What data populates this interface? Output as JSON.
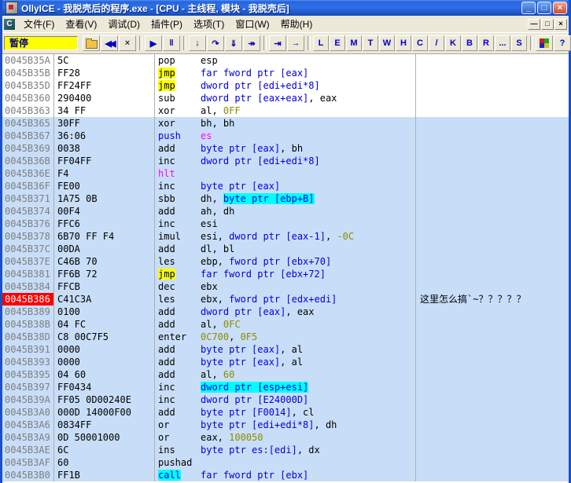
{
  "window": {
    "title": "OllyICE - 我脱壳后的程序.exe - [CPU - 主线程, 模块 - 我脱壳后]",
    "controls": {
      "minimize": "_",
      "maximize": "□",
      "close": "×"
    }
  },
  "menu": {
    "mdi_icon_label": "C",
    "items": [
      "文件(F)",
      "查看(V)",
      "调试(D)",
      "插件(P)",
      "选项(T)",
      "窗口(W)",
      "帮助(H)"
    ],
    "mdi": {
      "minimize": "―",
      "restore": "□",
      "close": "×"
    }
  },
  "toolbar": {
    "status_label": "暂停",
    "buttons": [
      {
        "name": "open-file-button",
        "icon": "folder-icon"
      },
      {
        "name": "restart-button",
        "glyph": "◀◀",
        "color": "#0000C0"
      },
      {
        "name": "close-program-button",
        "glyph": "×",
        "color": "#303030"
      },
      {
        "sep": true
      },
      {
        "name": "run-button",
        "glyph": "▶",
        "color": "#0000C0"
      },
      {
        "name": "pause-button",
        "glyph": "‖",
        "color": "#0000C0"
      },
      {
        "sep": true
      },
      {
        "name": "step-into-button",
        "glyph": "↓",
        "color": "#0000C0"
      },
      {
        "name": "step-over-button",
        "glyph": "↷",
        "color": "#0000C0"
      },
      {
        "name": "animate-into-button",
        "glyph": "⇓",
        "color": "#0000C0"
      },
      {
        "name": "animate-over-button",
        "glyph": "↠",
        "color": "#0000C0"
      },
      {
        "sep": true
      },
      {
        "name": "execute-till-return-button",
        "glyph": "⇥",
        "color": "#0000C0"
      },
      {
        "name": "go-to-address-button",
        "glyph": "→",
        "color": "#0000C0"
      },
      {
        "sep": true
      }
    ],
    "window_buttons": [
      {
        "name": "log-window-button",
        "label": "L"
      },
      {
        "name": "executables-window-button",
        "label": "E"
      },
      {
        "name": "memory-window-button",
        "label": "M"
      },
      {
        "name": "threads-window-button",
        "label": "T"
      },
      {
        "name": "windows-window-button",
        "label": "W"
      },
      {
        "name": "handles-window-button",
        "label": "H"
      },
      {
        "name": "cpu-window-button",
        "label": "C"
      },
      {
        "name": "patches-window-button",
        "label": "/"
      },
      {
        "name": "call-stack-window-button",
        "label": "K"
      },
      {
        "name": "breakpoints-window-button",
        "label": "B"
      },
      {
        "name": "references-window-button",
        "label": "R"
      },
      {
        "name": "run-trace-window-button",
        "label": "..."
      },
      {
        "name": "source-window-button",
        "label": "S"
      }
    ],
    "right_buttons": [
      {
        "name": "appearance-button",
        "icon": "palette-icon"
      },
      {
        "name": "help-button",
        "glyph": "?",
        "color": "#0000C0"
      }
    ]
  },
  "colors": {
    "selection_bg": "#C8DEF8",
    "breakpoint_bg": "#FF0000",
    "jump_highlight_bg": "#FFFF00",
    "operand_highlight_bg": "#00FFFF",
    "memory_operand": "#0000D8",
    "constant": "#8B8B00",
    "status_bg": "#FFFF00"
  },
  "disassembly": {
    "rows": [
      {
        "address": "0045B35A",
        "bytes": "5C",
        "mnemonic": "pop",
        "operands": [
          {
            "t": "esp",
            "s": "reg"
          }
        ],
        "selected": false
      },
      {
        "address": "0045B35B",
        "bytes": "FF28",
        "mnemonic": "jmp",
        "mstyle": "jmp",
        "operands": [
          {
            "t": "far fword ptr [eax]",
            "s": "mem"
          }
        ],
        "selected": false
      },
      {
        "address": "0045B35D",
        "bytes": "FF24FF",
        "mnemonic": "jmp",
        "mstyle": "jmp",
        "operands": [
          {
            "t": "dword ptr [edi+edi*8]",
            "s": "mem"
          }
        ],
        "selected": false
      },
      {
        "address": "0045B360",
        "bytes": "290400",
        "mnemonic": "sub",
        "operands": [
          {
            "t": "dword ptr [eax+eax]",
            "s": "mem"
          },
          {
            "t": ", ",
            "s": "reg"
          },
          {
            "t": "eax",
            "s": "reg"
          }
        ],
        "selected": false
      },
      {
        "address": "0045B363",
        "bytes": "34 FF",
        "mnemonic": "xor",
        "operands": [
          {
            "t": "al, ",
            "s": "reg"
          },
          {
            "t": "0FF",
            "s": "const"
          }
        ],
        "selected": false
      },
      {
        "address": "0045B365",
        "bytes": "30FF",
        "mnemonic": "xor",
        "operands": [
          {
            "t": "bh, bh",
            "s": "reg"
          }
        ],
        "selected": true
      },
      {
        "address": "0045B367",
        "bytes": "36:06",
        "mnemonic": "push",
        "mstyle": "push",
        "operands": [
          {
            "t": "es",
            "s": "seg"
          }
        ],
        "selected": true
      },
      {
        "address": "0045B369",
        "bytes": "0038",
        "mnemonic": "add",
        "operands": [
          {
            "t": "byte ptr [eax]",
            "s": "mem"
          },
          {
            "t": ", ",
            "s": "reg"
          },
          {
            "t": "bh",
            "s": "reg"
          }
        ],
        "selected": true
      },
      {
        "address": "0045B36B",
        "bytes": "FF04FF",
        "mnemonic": "inc",
        "operands": [
          {
            "t": "dword ptr [edi+edi*8]",
            "s": "mem"
          }
        ],
        "selected": true
      },
      {
        "address": "0045B36E",
        "bytes": "F4",
        "mnemonic": "hlt",
        "mstyle": "hlt",
        "operands": [],
        "selected": true
      },
      {
        "address": "0045B36F",
        "bytes": "FE00",
        "mnemonic": "inc",
        "operands": [
          {
            "t": "byte ptr [eax]",
            "s": "mem"
          }
        ],
        "selected": true
      },
      {
        "address": "0045B371",
        "bytes": "1A75 0B",
        "mnemonic": "sbb",
        "operands": [
          {
            "t": "dh, ",
            "s": "reg"
          },
          {
            "t": "byte ptr [ebp+B]",
            "s": "memhl"
          }
        ],
        "selected": true
      },
      {
        "address": "0045B374",
        "bytes": "00F4",
        "mnemonic": "add",
        "operands": [
          {
            "t": "ah, dh",
            "s": "reg"
          }
        ],
        "selected": true
      },
      {
        "address": "0045B376",
        "bytes": "FFC6",
        "mnemonic": "inc",
        "operands": [
          {
            "t": "esi",
            "s": "reg"
          }
        ],
        "selected": true
      },
      {
        "address": "0045B378",
        "bytes": "6B70 FF F4",
        "mnemonic": "imul",
        "operands": [
          {
            "t": "esi, ",
            "s": "reg"
          },
          {
            "t": "dword ptr [eax-1]",
            "s": "mem"
          },
          {
            "t": ", ",
            "s": "reg"
          },
          {
            "t": "-0C",
            "s": "const"
          }
        ],
        "selected": true
      },
      {
        "address": "0045B37C",
        "bytes": "00DA",
        "mnemonic": "add",
        "operands": [
          {
            "t": "dl, bl",
            "s": "reg"
          }
        ],
        "selected": true
      },
      {
        "address": "0045B37E",
        "bytes": "C46B 70",
        "mnemonic": "les",
        "operands": [
          {
            "t": "ebp, ",
            "s": "reg"
          },
          {
            "t": "fword ptr [ebx+70]",
            "s": "mem"
          }
        ],
        "selected": true
      },
      {
        "address": "0045B381",
        "bytes": "FF6B 72",
        "mnemonic": "jmp",
        "mstyle": "jmp",
        "operands": [
          {
            "t": "far fword ptr [ebx+72]",
            "s": "mem"
          }
        ],
        "selected": true
      },
      {
        "address": "0045B384",
        "bytes": "FFCB",
        "mnemonic": "dec",
        "operands": [
          {
            "t": "ebx",
            "s": "reg"
          }
        ],
        "selected": true
      },
      {
        "address": "0045B386",
        "bytes": "C41C3A",
        "mnemonic": "les",
        "operands": [
          {
            "t": "ebx, ",
            "s": "reg"
          },
          {
            "t": "fword ptr [edx+edi]",
            "s": "mem"
          }
        ],
        "selected": true,
        "bp": true,
        "comment": "这里怎么搞`~？？？？？"
      },
      {
        "address": "0045B389",
        "bytes": "0100",
        "mnemonic": "add",
        "operands": [
          {
            "t": "dword ptr [eax]",
            "s": "mem"
          },
          {
            "t": ", ",
            "s": "reg"
          },
          {
            "t": "eax",
            "s": "reg"
          }
        ],
        "selected": true
      },
      {
        "address": "0045B38B",
        "bytes": "04 FC",
        "mnemonic": "add",
        "operands": [
          {
            "t": "al, ",
            "s": "reg"
          },
          {
            "t": "0FC",
            "s": "const"
          }
        ],
        "selected": true
      },
      {
        "address": "0045B38D",
        "bytes": "C8 00C7F5",
        "mnemonic": "enter",
        "operands": [
          {
            "t": "0C700",
            "s": "const"
          },
          {
            "t": ", ",
            "s": "reg"
          },
          {
            "t": "0F5",
            "s": "const"
          }
        ],
        "selected": true
      },
      {
        "address": "0045B391",
        "bytes": "0000",
        "mnemonic": "add",
        "operands": [
          {
            "t": "byte ptr [eax]",
            "s": "mem"
          },
          {
            "t": ", ",
            "s": "reg"
          },
          {
            "t": "al",
            "s": "reg"
          }
        ],
        "selected": true
      },
      {
        "address": "0045B393",
        "bytes": "0000",
        "mnemonic": "add",
        "operands": [
          {
            "t": "byte ptr [eax]",
            "s": "mem"
          },
          {
            "t": ", ",
            "s": "reg"
          },
          {
            "t": "al",
            "s": "reg"
          }
        ],
        "selected": true
      },
      {
        "address": "0045B395",
        "bytes": "04 60",
        "mnemonic": "add",
        "operands": [
          {
            "t": "al, ",
            "s": "reg"
          },
          {
            "t": "60",
            "s": "const"
          }
        ],
        "selected": true
      },
      {
        "address": "0045B397",
        "bytes": "FF0434",
        "mnemonic": "inc",
        "operands": [
          {
            "t": "dword ptr [esp+esi]",
            "s": "memhl"
          }
        ],
        "selected": true
      },
      {
        "address": "0045B39A",
        "bytes": "FF05 0D00240E",
        "mnemonic": "inc",
        "operands": [
          {
            "t": "dword ptr [E24000D]",
            "s": "mem"
          }
        ],
        "selected": true
      },
      {
        "address": "0045B3A0",
        "bytes": "000D 14000F00",
        "mnemonic": "add",
        "operands": [
          {
            "t": "byte ptr [F0014]",
            "s": "mem"
          },
          {
            "t": ", ",
            "s": "reg"
          },
          {
            "t": "cl",
            "s": "reg"
          }
        ],
        "selected": true
      },
      {
        "address": "0045B3A6",
        "bytes": "0834FF",
        "mnemonic": "or",
        "operands": [
          {
            "t": "byte ptr [edi+edi*8]",
            "s": "mem"
          },
          {
            "t": ", ",
            "s": "reg"
          },
          {
            "t": "dh",
            "s": "reg"
          }
        ],
        "selected": true
      },
      {
        "address": "0045B3A9",
        "bytes": "0D 50001000",
        "mnemonic": "or",
        "operands": [
          {
            "t": "eax, ",
            "s": "reg"
          },
          {
            "t": "100050",
            "s": "const"
          }
        ],
        "selected": true
      },
      {
        "address": "0045B3AE",
        "bytes": "6C",
        "mnemonic": "ins",
        "operands": [
          {
            "t": "byte ptr es:[edi]",
            "s": "mem"
          },
          {
            "t": ", ",
            "s": "reg"
          },
          {
            "t": "dx",
            "s": "reg"
          }
        ],
        "selected": true
      },
      {
        "address": "0045B3AF",
        "bytes": "60",
        "mnemonic": "pushad",
        "operands": [],
        "selected": true
      },
      {
        "address": "0045B3B0",
        "bytes": "FF1B",
        "mnemonic": "call",
        "mstyle": "call",
        "operands": [
          {
            "t": "far fword ptr [ebx]",
            "s": "mem"
          }
        ],
        "selected": true
      }
    ]
  }
}
